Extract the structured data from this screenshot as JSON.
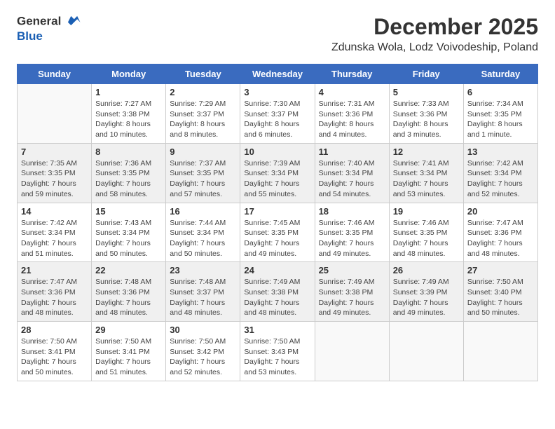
{
  "logo": {
    "line1": "General",
    "line2": "Blue"
  },
  "title": "December 2025",
  "subtitle": "Zdunska Wola, Lodz Voivodeship, Poland",
  "headers": [
    "Sunday",
    "Monday",
    "Tuesday",
    "Wednesday",
    "Thursday",
    "Friday",
    "Saturday"
  ],
  "rows": [
    [
      {
        "day": "",
        "type": "empty",
        "lines": []
      },
      {
        "day": "1",
        "type": "normal",
        "lines": [
          "Sunrise: 7:27 AM",
          "Sunset: 3:38 PM",
          "Daylight: 8 hours",
          "and 10 minutes."
        ]
      },
      {
        "day": "2",
        "type": "normal",
        "lines": [
          "Sunrise: 7:29 AM",
          "Sunset: 3:37 PM",
          "Daylight: 8 hours",
          "and 8 minutes."
        ]
      },
      {
        "day": "3",
        "type": "normal",
        "lines": [
          "Sunrise: 7:30 AM",
          "Sunset: 3:37 PM",
          "Daylight: 8 hours",
          "and 6 minutes."
        ]
      },
      {
        "day": "4",
        "type": "normal",
        "lines": [
          "Sunrise: 7:31 AM",
          "Sunset: 3:36 PM",
          "Daylight: 8 hours",
          "and 4 minutes."
        ]
      },
      {
        "day": "5",
        "type": "normal",
        "lines": [
          "Sunrise: 7:33 AM",
          "Sunset: 3:36 PM",
          "Daylight: 8 hours",
          "and 3 minutes."
        ]
      },
      {
        "day": "6",
        "type": "normal",
        "lines": [
          "Sunrise: 7:34 AM",
          "Sunset: 3:35 PM",
          "Daylight: 8 hours",
          "and 1 minute."
        ]
      }
    ],
    [
      {
        "day": "7",
        "type": "shaded",
        "lines": [
          "Sunrise: 7:35 AM",
          "Sunset: 3:35 PM",
          "Daylight: 7 hours",
          "and 59 minutes."
        ]
      },
      {
        "day": "8",
        "type": "shaded",
        "lines": [
          "Sunrise: 7:36 AM",
          "Sunset: 3:35 PM",
          "Daylight: 7 hours",
          "and 58 minutes."
        ]
      },
      {
        "day": "9",
        "type": "shaded",
        "lines": [
          "Sunrise: 7:37 AM",
          "Sunset: 3:35 PM",
          "Daylight: 7 hours",
          "and 57 minutes."
        ]
      },
      {
        "day": "10",
        "type": "shaded",
        "lines": [
          "Sunrise: 7:39 AM",
          "Sunset: 3:34 PM",
          "Daylight: 7 hours",
          "and 55 minutes."
        ]
      },
      {
        "day": "11",
        "type": "shaded",
        "lines": [
          "Sunrise: 7:40 AM",
          "Sunset: 3:34 PM",
          "Daylight: 7 hours",
          "and 54 minutes."
        ]
      },
      {
        "day": "12",
        "type": "shaded",
        "lines": [
          "Sunrise: 7:41 AM",
          "Sunset: 3:34 PM",
          "Daylight: 7 hours",
          "and 53 minutes."
        ]
      },
      {
        "day": "13",
        "type": "shaded",
        "lines": [
          "Sunrise: 7:42 AM",
          "Sunset: 3:34 PM",
          "Daylight: 7 hours",
          "and 52 minutes."
        ]
      }
    ],
    [
      {
        "day": "14",
        "type": "normal",
        "lines": [
          "Sunrise: 7:42 AM",
          "Sunset: 3:34 PM",
          "Daylight: 7 hours",
          "and 51 minutes."
        ]
      },
      {
        "day": "15",
        "type": "normal",
        "lines": [
          "Sunrise: 7:43 AM",
          "Sunset: 3:34 PM",
          "Daylight: 7 hours",
          "and 50 minutes."
        ]
      },
      {
        "day": "16",
        "type": "normal",
        "lines": [
          "Sunrise: 7:44 AM",
          "Sunset: 3:34 PM",
          "Daylight: 7 hours",
          "and 50 minutes."
        ]
      },
      {
        "day": "17",
        "type": "normal",
        "lines": [
          "Sunrise: 7:45 AM",
          "Sunset: 3:35 PM",
          "Daylight: 7 hours",
          "and 49 minutes."
        ]
      },
      {
        "day": "18",
        "type": "normal",
        "lines": [
          "Sunrise: 7:46 AM",
          "Sunset: 3:35 PM",
          "Daylight: 7 hours",
          "and 49 minutes."
        ]
      },
      {
        "day": "19",
        "type": "normal",
        "lines": [
          "Sunrise: 7:46 AM",
          "Sunset: 3:35 PM",
          "Daylight: 7 hours",
          "and 48 minutes."
        ]
      },
      {
        "day": "20",
        "type": "normal",
        "lines": [
          "Sunrise: 7:47 AM",
          "Sunset: 3:36 PM",
          "Daylight: 7 hours",
          "and 48 minutes."
        ]
      }
    ],
    [
      {
        "day": "21",
        "type": "shaded",
        "lines": [
          "Sunrise: 7:47 AM",
          "Sunset: 3:36 PM",
          "Daylight: 7 hours",
          "and 48 minutes."
        ]
      },
      {
        "day": "22",
        "type": "shaded",
        "lines": [
          "Sunrise: 7:48 AM",
          "Sunset: 3:36 PM",
          "Daylight: 7 hours",
          "and 48 minutes."
        ]
      },
      {
        "day": "23",
        "type": "shaded",
        "lines": [
          "Sunrise: 7:48 AM",
          "Sunset: 3:37 PM",
          "Daylight: 7 hours",
          "and 48 minutes."
        ]
      },
      {
        "day": "24",
        "type": "shaded",
        "lines": [
          "Sunrise: 7:49 AM",
          "Sunset: 3:38 PM",
          "Daylight: 7 hours",
          "and 48 minutes."
        ]
      },
      {
        "day": "25",
        "type": "shaded",
        "lines": [
          "Sunrise: 7:49 AM",
          "Sunset: 3:38 PM",
          "Daylight: 7 hours",
          "and 49 minutes."
        ]
      },
      {
        "day": "26",
        "type": "shaded",
        "lines": [
          "Sunrise: 7:49 AM",
          "Sunset: 3:39 PM",
          "Daylight: 7 hours",
          "and 49 minutes."
        ]
      },
      {
        "day": "27",
        "type": "shaded",
        "lines": [
          "Sunrise: 7:50 AM",
          "Sunset: 3:40 PM",
          "Daylight: 7 hours",
          "and 50 minutes."
        ]
      }
    ],
    [
      {
        "day": "28",
        "type": "normal",
        "lines": [
          "Sunrise: 7:50 AM",
          "Sunset: 3:41 PM",
          "Daylight: 7 hours",
          "and 50 minutes."
        ]
      },
      {
        "day": "29",
        "type": "normal",
        "lines": [
          "Sunrise: 7:50 AM",
          "Sunset: 3:41 PM",
          "Daylight: 7 hours",
          "and 51 minutes."
        ]
      },
      {
        "day": "30",
        "type": "normal",
        "lines": [
          "Sunrise: 7:50 AM",
          "Sunset: 3:42 PM",
          "Daylight: 7 hours",
          "and 52 minutes."
        ]
      },
      {
        "day": "31",
        "type": "normal",
        "lines": [
          "Sunrise: 7:50 AM",
          "Sunset: 3:43 PM",
          "Daylight: 7 hours",
          "and 53 minutes."
        ]
      },
      {
        "day": "",
        "type": "empty",
        "lines": []
      },
      {
        "day": "",
        "type": "empty",
        "lines": []
      },
      {
        "day": "",
        "type": "empty",
        "lines": []
      }
    ]
  ]
}
